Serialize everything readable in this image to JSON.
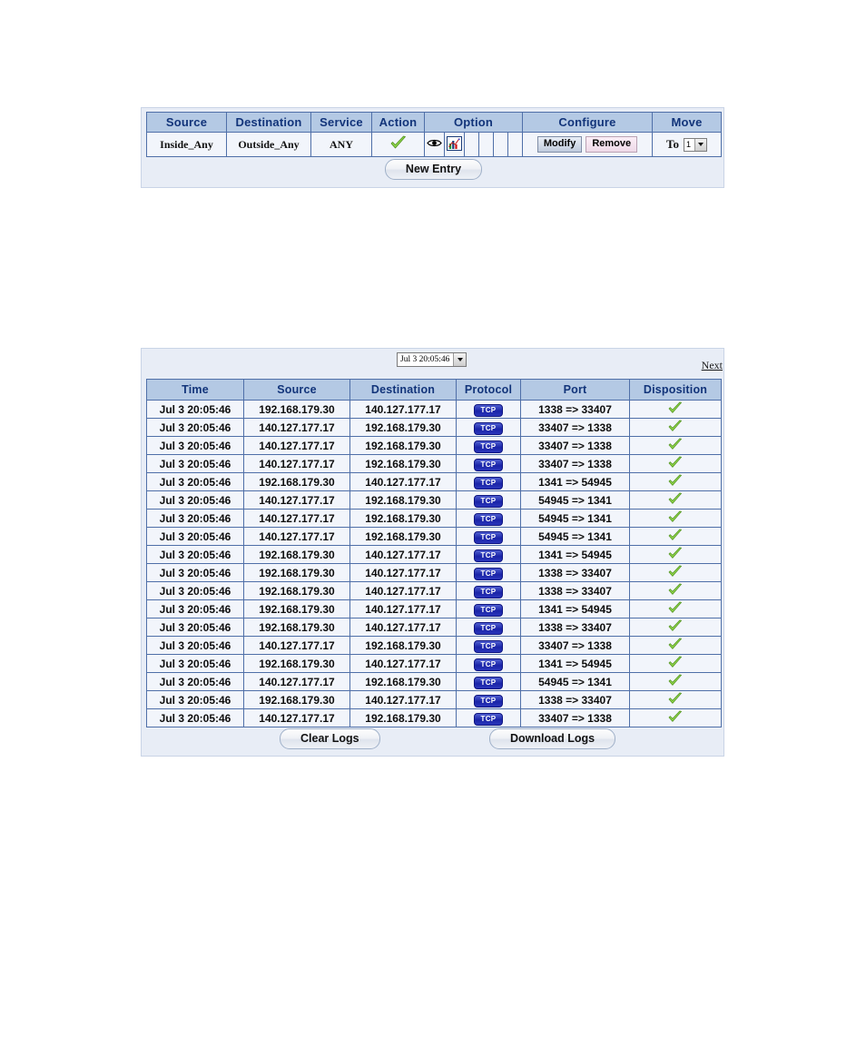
{
  "rules": {
    "headers": [
      "Source",
      "Destination",
      "Service",
      "Action",
      "Option",
      "Configure",
      "Move"
    ],
    "row": {
      "source": "Inside_Any",
      "destination": "Outside_Any",
      "service": "ANY",
      "action_icon": "green-check-icon",
      "option_icons": [
        "eye-icon",
        "bar-chart-icon"
      ],
      "option_empty_cells": 4,
      "modify_label": "Modify",
      "remove_label": "Remove",
      "move_label": "To",
      "move_value": "1"
    },
    "new_entry_label": "New Entry"
  },
  "logs": {
    "date_filter_value": "Jul 3 20:05:46",
    "next_label": "Next",
    "headers": [
      "Time",
      "Source",
      "Destination",
      "Protocol",
      "Port",
      "Disposition"
    ],
    "clear_label": "Clear Logs",
    "download_label": "Download Logs",
    "rows": [
      {
        "time": "Jul 3 20:05:46",
        "source": "192.168.179.30",
        "destination": "140.127.177.17",
        "protocol": "TCP",
        "port": "1338 => 33407",
        "disposition": "green-check-icon"
      },
      {
        "time": "Jul 3 20:05:46",
        "source": "140.127.177.17",
        "destination": "192.168.179.30",
        "protocol": "TCP",
        "port": "33407 => 1338",
        "disposition": "green-check-icon"
      },
      {
        "time": "Jul 3 20:05:46",
        "source": "140.127.177.17",
        "destination": "192.168.179.30",
        "protocol": "TCP",
        "port": "33407 => 1338",
        "disposition": "green-check-icon"
      },
      {
        "time": "Jul 3 20:05:46",
        "source": "140.127.177.17",
        "destination": "192.168.179.30",
        "protocol": "TCP",
        "port": "33407 => 1338",
        "disposition": "green-check-icon"
      },
      {
        "time": "Jul 3 20:05:46",
        "source": "192.168.179.30",
        "destination": "140.127.177.17",
        "protocol": "TCP",
        "port": "1341 => 54945",
        "disposition": "green-check-icon"
      },
      {
        "time": "Jul 3 20:05:46",
        "source": "140.127.177.17",
        "destination": "192.168.179.30",
        "protocol": "TCP",
        "port": "54945 => 1341",
        "disposition": "green-check-icon"
      },
      {
        "time": "Jul 3 20:05:46",
        "source": "140.127.177.17",
        "destination": "192.168.179.30",
        "protocol": "TCP",
        "port": "54945 => 1341",
        "disposition": "green-check-icon"
      },
      {
        "time": "Jul 3 20:05:46",
        "source": "140.127.177.17",
        "destination": "192.168.179.30",
        "protocol": "TCP",
        "port": "54945 => 1341",
        "disposition": "green-check-icon"
      },
      {
        "time": "Jul 3 20:05:46",
        "source": "192.168.179.30",
        "destination": "140.127.177.17",
        "protocol": "TCP",
        "port": "1341 => 54945",
        "disposition": "green-check-icon"
      },
      {
        "time": "Jul 3 20:05:46",
        "source": "192.168.179.30",
        "destination": "140.127.177.17",
        "protocol": "TCP",
        "port": "1338 => 33407",
        "disposition": "green-check-icon"
      },
      {
        "time": "Jul 3 20:05:46",
        "source": "192.168.179.30",
        "destination": "140.127.177.17",
        "protocol": "TCP",
        "port": "1338 => 33407",
        "disposition": "green-check-icon"
      },
      {
        "time": "Jul 3 20:05:46",
        "source": "192.168.179.30",
        "destination": "140.127.177.17",
        "protocol": "TCP",
        "port": "1341 => 54945",
        "disposition": "green-check-icon"
      },
      {
        "time": "Jul 3 20:05:46",
        "source": "192.168.179.30",
        "destination": "140.127.177.17",
        "protocol": "TCP",
        "port": "1338 => 33407",
        "disposition": "green-check-icon"
      },
      {
        "time": "Jul 3 20:05:46",
        "source": "140.127.177.17",
        "destination": "192.168.179.30",
        "protocol": "TCP",
        "port": "33407 => 1338",
        "disposition": "green-check-icon"
      },
      {
        "time": "Jul 3 20:05:46",
        "source": "192.168.179.30",
        "destination": "140.127.177.17",
        "protocol": "TCP",
        "port": "1341 => 54945",
        "disposition": "green-check-icon"
      },
      {
        "time": "Jul 3 20:05:46",
        "source": "140.127.177.17",
        "destination": "192.168.179.30",
        "protocol": "TCP",
        "port": "54945 => 1341",
        "disposition": "green-check-icon"
      },
      {
        "time": "Jul 3 20:05:46",
        "source": "192.168.179.30",
        "destination": "140.127.177.17",
        "protocol": "TCP",
        "port": "1338 => 33407",
        "disposition": "green-check-icon"
      },
      {
        "time": "Jul 3 20:05:46",
        "source": "140.127.177.17",
        "destination": "192.168.179.30",
        "protocol": "TCP",
        "port": "33407 => 1338",
        "disposition": "green-check-icon"
      }
    ]
  },
  "colors": {
    "header_bg": "#b4c9e4",
    "header_text": "#12347a",
    "row_bg": "#f2f5fb",
    "panel_bg": "#e8edf6",
    "border": "#4f6fa8",
    "tcp_badge": "#1a24a8",
    "check_green": "#7cc342"
  }
}
